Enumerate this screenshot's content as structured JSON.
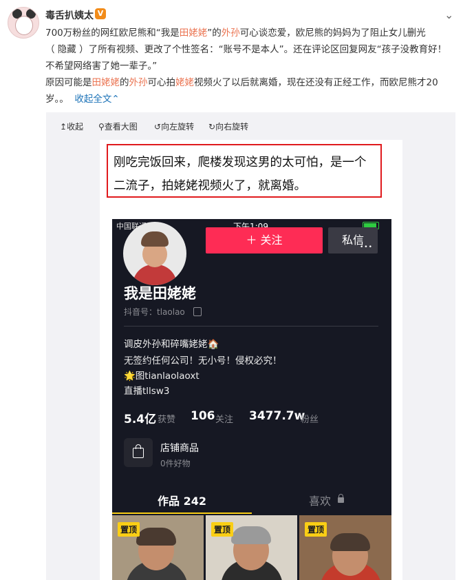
{
  "post": {
    "author": "毒舌扒姨太",
    "verified_badge": "V",
    "text_line1_a": "700万粉丝的网红欧尼熊和“我是",
    "text_line1_b": "田姥姥",
    "text_line1_c": "”的",
    "text_line1_d": "外孙",
    "text_line1_e": "可心谈恋爱，欧尼熊的妈妈为了阻止女儿删光",
    "text_line2": "（ 隐藏 ）了所有视频、更改了个性签名：“账号不是本人”。还在评论区回复网友“孩子没教育好！",
    "text_line3": "不希望网络害了她一辈子。”",
    "text_line4_a": "原因可能是",
    "text_line4_b": "田姥姥",
    "text_line4_c": "的",
    "text_line4_d": "外孙",
    "text_line4_e": "可心拍",
    "text_line4_f": "姥姥",
    "text_line4_g": "视频火了以后就离婚，现在还没有正经工作，而欧尼熊才20",
    "text_line5": "岁。。",
    "collapse_link": "收起全文"
  },
  "toolbar": {
    "collapse": "收起",
    "view_large": "查看大图",
    "rotate_left": "向左旋转",
    "rotate_right": "向右旋转"
  },
  "caption": "刚吃完饭回来，爬楼发现这男的太可怕，是一个二流子，拍姥姥视频火了，就离婚。",
  "phone": {
    "status_carrier": "中国联通 4G",
    "status_time": "下午1:09",
    "follow_button": "＋ 关注",
    "message_button": "私信",
    "more_dots": "•••",
    "profile_name": "我是田姥姥",
    "douyin_id": "抖音号：tlaolao",
    "bio_line1": "调皮外孙和碎嘴姥姥🏠",
    "bio_line2": "无签约任何公司！无小号！侵权必究！",
    "bio_line3": "🌟图tianlaolaoxt",
    "bio_line4": "直播tllsw3",
    "stats": {
      "likes_value": "5.4亿",
      "likes_label": "获赞",
      "following_value": "106",
      "following_label": "关注",
      "fans_value": "3477.7w",
      "fans_label": "粉丝"
    },
    "shop_title": "店铺商品",
    "shop_subtitle": "0件好物",
    "tab_works": "作品 242",
    "tab_likes": "喜欢",
    "pinned_label": "置顶"
  },
  "colors": {
    "highlight": "#eb7350",
    "link": "#1d73b8",
    "follow": "#fe2c55",
    "caption_border": "#e0191c",
    "phone_bg": "#161823"
  }
}
